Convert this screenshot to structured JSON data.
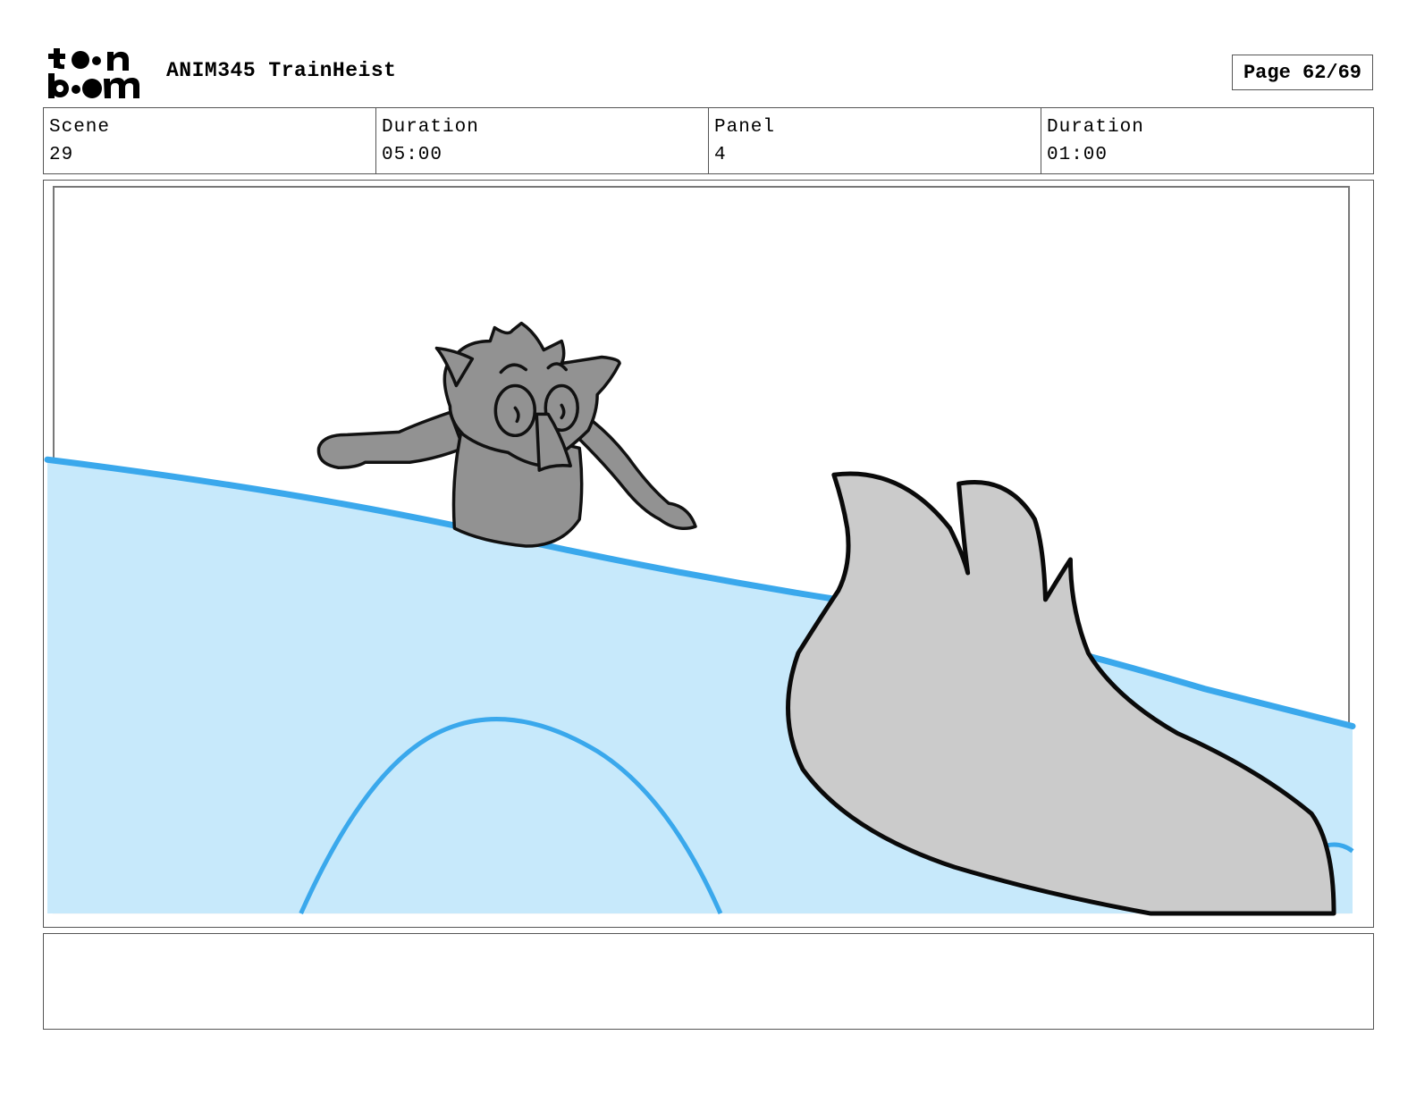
{
  "header": {
    "logo_text": "toon boom",
    "project_title": "ANIM345 TrainHeist",
    "page_label": "Page 62/69"
  },
  "info": {
    "scene_label": "Scene",
    "scene_value": "29",
    "scene_duration_label": "Duration",
    "scene_duration_value": "05:00",
    "panel_label": "Panel",
    "panel_value": "4",
    "panel_duration_label": "Duration",
    "panel_duration_value": "01:00"
  },
  "colors": {
    "water_fill": "#c7e9fb",
    "water_line": "#3aa8ec",
    "character_fill": "#929292",
    "tail_fill": "#cbcbcb",
    "border": "#555555"
  },
  "notes": {
    "text": ""
  }
}
